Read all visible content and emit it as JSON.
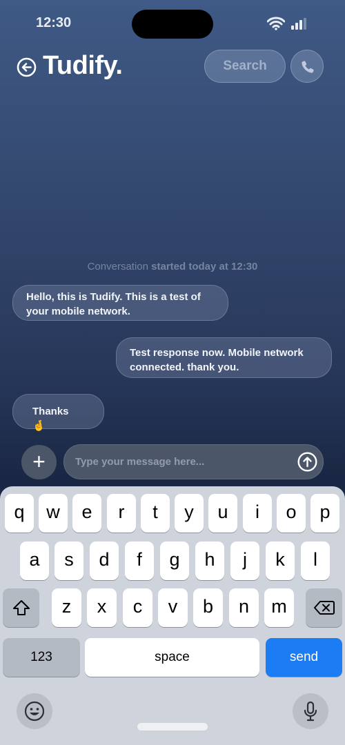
{
  "status_bar": {
    "time": "12:30"
  },
  "header": {
    "brand": "Tudify.",
    "search_label": "Search"
  },
  "conversation": {
    "started_prefix": "Conversation",
    "started_suffix": "started today at 12:30",
    "messages": [
      {
        "from": "bot",
        "text": "Hello, this is Tudify. This is a test of your mobile network."
      },
      {
        "from": "user",
        "text": "Test response now. Mobile network connected. thank you."
      },
      {
        "from": "bot",
        "text": "Thanks 🤞"
      }
    ]
  },
  "composer": {
    "placeholder": "Type your message here...",
    "value": "",
    "plus_label": "+"
  },
  "keyboard": {
    "row1": [
      "q",
      "w",
      "e",
      "r",
      "t",
      "y",
      "u",
      "i",
      "o",
      "p"
    ],
    "row2": [
      "a",
      "s",
      "d",
      "f",
      "g",
      "h",
      "j",
      "k",
      "l"
    ],
    "row3": [
      "z",
      "x",
      "c",
      "v",
      "b",
      "n",
      "m"
    ],
    "numbers_label": "123",
    "space_label": "space",
    "send_label": "send"
  },
  "colors": {
    "accent": "#1b7cf4",
    "keyboard_bg": "#cfd4dc"
  }
}
